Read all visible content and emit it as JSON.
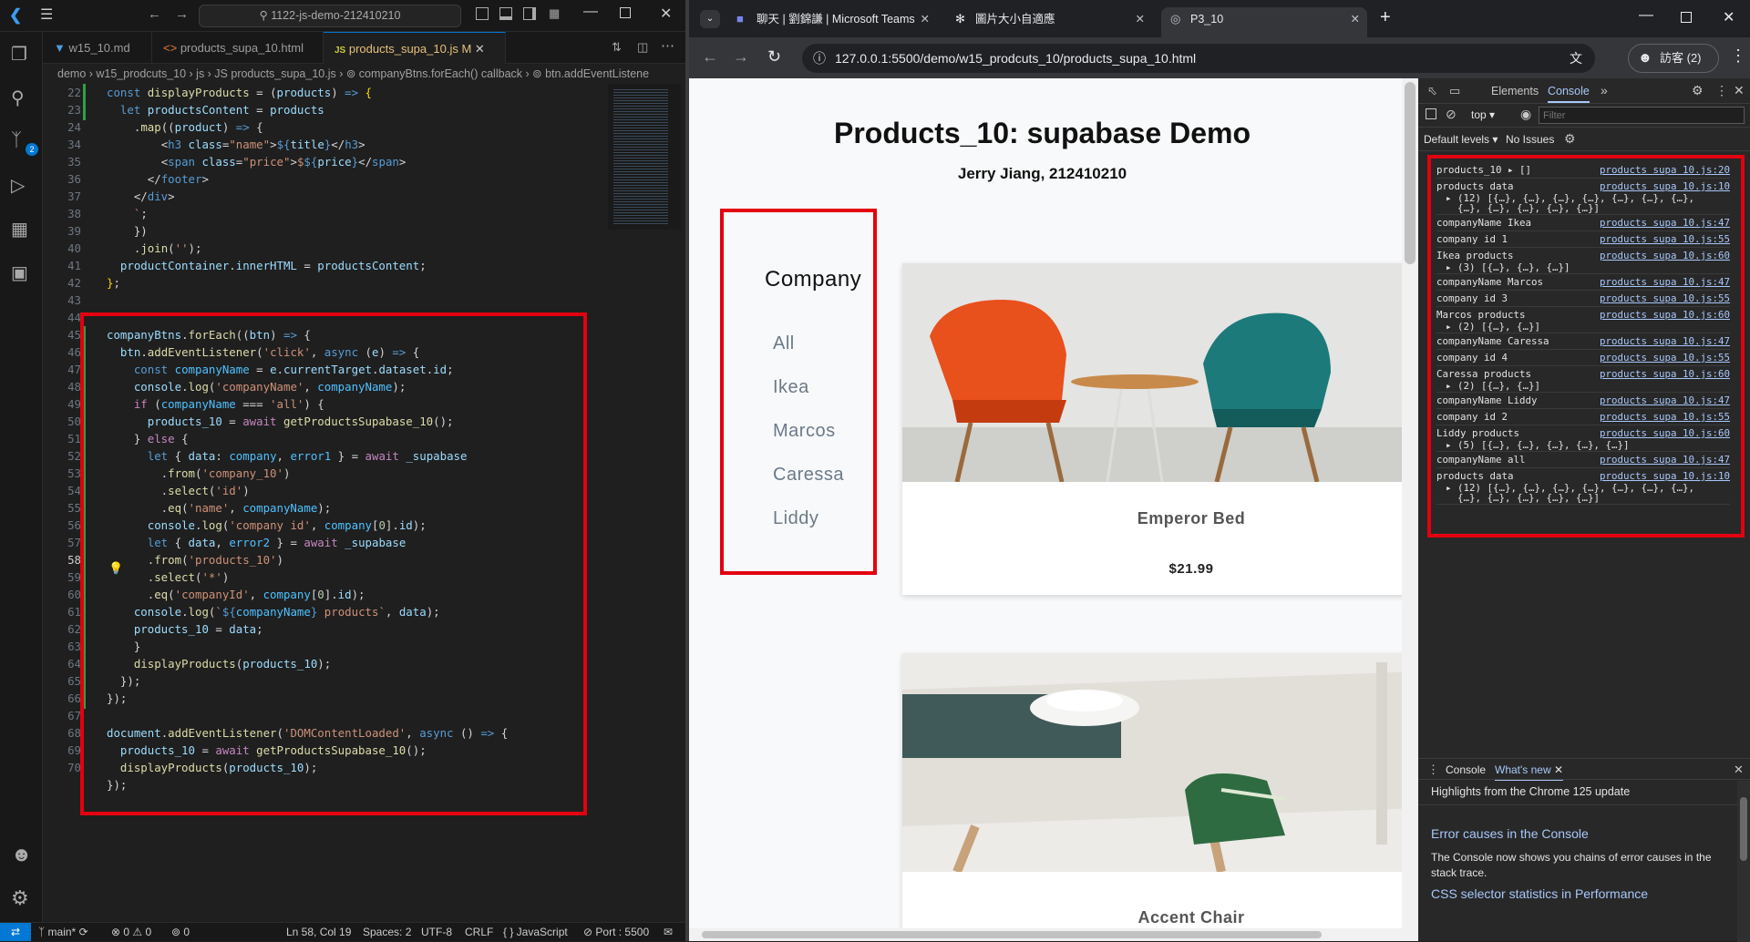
{
  "vscode": {
    "search": "1122-js-demo-212410210",
    "tabs": [
      {
        "label": "w15_10.md"
      },
      {
        "label": "products_supa_10.html"
      },
      {
        "label": "products_supa_10.js M"
      }
    ],
    "breadcrumb": "demo › w15_prodcuts_10 › js › JS products_supa_10.js › ⊚ companyBtns.forEach() callback › ⊚ btn.addEventListene",
    "line_numbers": [
      "22",
      "23",
      "24",
      "34",
      "35",
      "36",
      "37",
      "38",
      "39",
      "40",
      "41",
      "42",
      "43",
      "44",
      "45",
      "46",
      "47",
      "48",
      "49",
      "50",
      "51",
      "52",
      "53",
      "54",
      "55",
      "56",
      "57",
      "58",
      "59",
      "60",
      "61",
      "62",
      "63",
      "64",
      "65",
      "66",
      "67",
      "68",
      "69",
      "70"
    ],
    "status": {
      "branch": "main*",
      "errors": "⊗ 0 ⚠ 0",
      "ports": "⊚ 0",
      "position": "Ln 58, Col 19",
      "spaces": "Spaces: 2",
      "encoding": "UTF-8",
      "eol": "CRLF",
      "language": "{ } JavaScript",
      "port": "Port : 5500"
    }
  },
  "chrome": {
    "tabs": [
      {
        "label": "聊天 | 劉錦謙 | Microsoft Teams"
      },
      {
        "label": "圖片大小自適應"
      },
      {
        "label": "P3_10"
      }
    ],
    "url": "127.0.0.1:5500/demo/w15_prodcuts_10/products_supa_10.html",
    "profile": "訪客 (2)"
  },
  "page": {
    "title": "Products_10: supabase Demo",
    "subtitle": "Jerry Jiang, 212410210",
    "sidebar_title": "Company",
    "companies": [
      "All",
      "Ikea",
      "Marcos",
      "Caressa",
      "Liddy"
    ],
    "products": [
      {
        "name": "Emperor Bed",
        "price": "$21.99"
      },
      {
        "name": "Accent Chair",
        "price": ""
      }
    ]
  },
  "devtools": {
    "tabs": [
      "Elements",
      "Console"
    ],
    "context": "top",
    "filter_placeholder": "Filter",
    "levels": "Default levels",
    "issues": "No Issues",
    "messages": [
      {
        "text": "products_10  ▸ []",
        "src": "products supa 10.js:20",
        "sub": ""
      },
      {
        "text": "products data",
        "src": "products supa 10.js:10",
        "sub": "▸ (12) [{…}, {…}, {…}, {…}, {…}, {…}, {…},\n  {…}, {…}, {…}, {…}, {…}]"
      },
      {
        "text": "companyName Ikea",
        "src": "products supa 10.js:47",
        "sub": ""
      },
      {
        "text": "company id 1",
        "src": "products supa 10.js:55",
        "sub": ""
      },
      {
        "text": "Ikea products",
        "src": "products supa 10.js:60",
        "sub": "▸ (3) [{…}, {…}, {…}]"
      },
      {
        "text": "companyName Marcos",
        "src": "products supa 10.js:47",
        "sub": ""
      },
      {
        "text": "company id 3",
        "src": "products supa 10.js:55",
        "sub": ""
      },
      {
        "text": "Marcos products",
        "src": "products supa 10.js:60",
        "sub": "▸ (2) [{…}, {…}]"
      },
      {
        "text": "companyName Caressa",
        "src": "products supa 10.js:47",
        "sub": ""
      },
      {
        "text": "company id 4",
        "src": "products supa 10.js:55",
        "sub": ""
      },
      {
        "text": "Caressa products",
        "src": "products supa 10.js:60",
        "sub": "▸ (2) [{…}, {…}]"
      },
      {
        "text": "companyName Liddy",
        "src": "products supa 10.js:47",
        "sub": ""
      },
      {
        "text": "company id 2",
        "src": "products supa 10.js:55",
        "sub": ""
      },
      {
        "text": "Liddy products",
        "src": "products supa 10.js:60",
        "sub": "▸ (5) [{…}, {…}, {…}, {…}, {…}]"
      },
      {
        "text": "companyName all",
        "src": "products supa 10.js:47",
        "sub": ""
      },
      {
        "text": "products data",
        "src": "products supa 10.js:10",
        "sub": "▸ (12) [{…}, {…}, {…}, {…}, {…}, {…}, {…},\n  {…}, {…}, {…}, {…}, {…}]"
      }
    ],
    "drawer": {
      "tab1": "Console",
      "tab2": "What's new",
      "highlights": "Highlights from the Chrome 125 update",
      "h1": "Error causes in the Console",
      "p1": "The Console now shows you chains of error causes in the stack trace.",
      "h2": "CSS selector statistics in Performance"
    }
  },
  "colors": {
    "highlight_box": "#e3000f",
    "vscode_accent": "#0078d4"
  }
}
